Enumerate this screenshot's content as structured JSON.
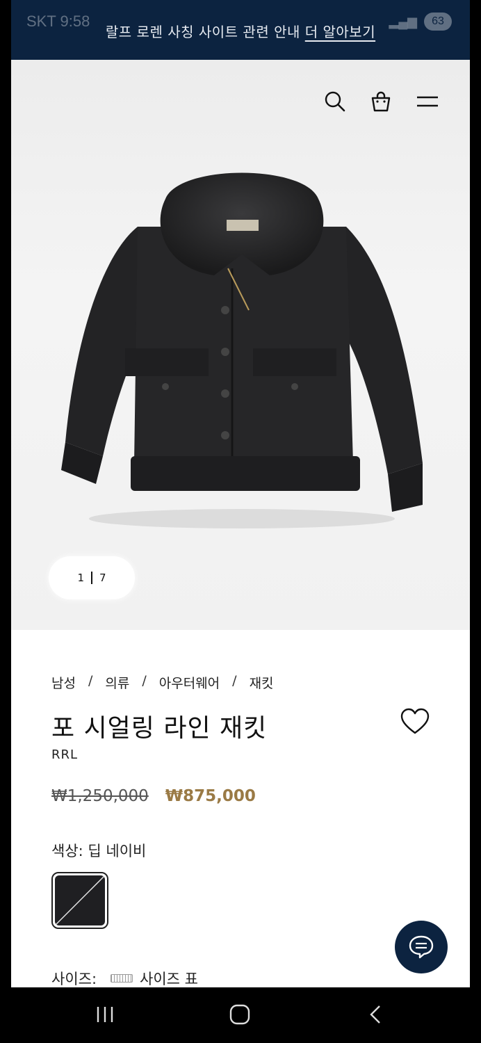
{
  "status_bar": {
    "left": "SKT 9:58",
    "battery": "63"
  },
  "banner": {
    "text": "랄프 로렌 사칭 사이트 관련 안내",
    "link": "더 알아보기"
  },
  "header": {
    "icons": [
      "search-icon",
      "shopping-bag-icon",
      "menu-icon"
    ]
  },
  "gallery": {
    "current": "1",
    "total": "7"
  },
  "breadcrumb": [
    "남성",
    "의류",
    "아우터웨어",
    "재킷"
  ],
  "product": {
    "title": "포 시얼링 라인 재킷",
    "brand": "RRL",
    "original_price": "₩1,250,000",
    "sale_price": "₩875,000",
    "color_label": "색상: 딥 네이비",
    "size_label": "사이즈:",
    "size_chart": "사이즈 표"
  },
  "colors": {
    "banner": "#0c2340",
    "sale_price": "#9a7a45"
  }
}
